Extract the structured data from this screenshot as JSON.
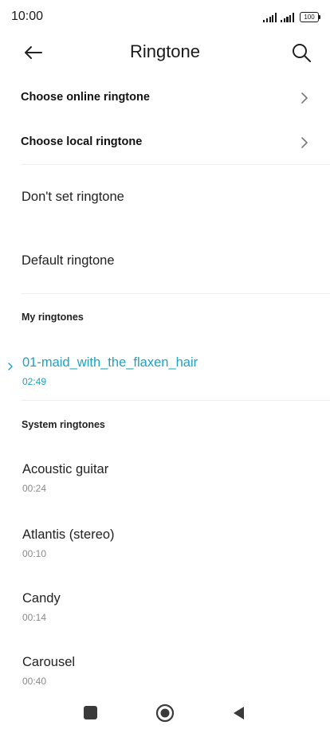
{
  "status_bar": {
    "time": "10:00",
    "battery": "100"
  },
  "header": {
    "title": "Ringtone"
  },
  "nav_rows": [
    {
      "label": "Choose online ringtone"
    },
    {
      "label": "Choose local ringtone"
    }
  ],
  "options": [
    {
      "label": "Don't set ringtone"
    },
    {
      "label": "Default ringtone"
    }
  ],
  "sections": {
    "my_ringtones": "My ringtones",
    "system_ringtones": "System ringtones"
  },
  "my_ringtones": [
    {
      "name": "01-maid_with_the_flaxen_hair",
      "duration": "02:49"
    }
  ],
  "system_ringtones": [
    {
      "name": "Acoustic guitar",
      "duration": "00:24"
    },
    {
      "name": "Atlantis (stereo)",
      "duration": "00:10"
    },
    {
      "name": "Candy",
      "duration": "00:14"
    },
    {
      "name": "Carousel",
      "duration": "00:40"
    }
  ],
  "colors": {
    "accent": "#1aa3c2",
    "text": "#222222",
    "secondary": "#8a8a8a"
  },
  "icons": {
    "back": "arrow-left-icon",
    "search": "search-icon",
    "chevron": "chevron-right-icon",
    "selected": "selected-marker-icon"
  }
}
